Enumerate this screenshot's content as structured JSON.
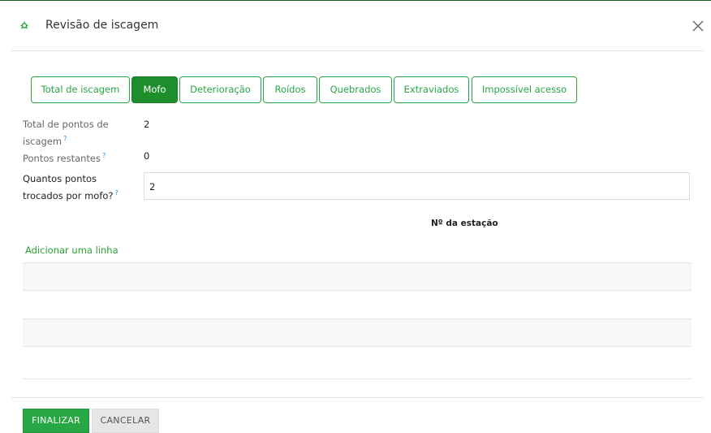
{
  "dialog": {
    "title": "Revisão de iscagem",
    "accent_color": "#28a745",
    "header_icon": "bug-icon",
    "close_icon": "close-icon"
  },
  "tabs": [
    {
      "label": "Total de iscagem",
      "active": false
    },
    {
      "label": "Mofo",
      "active": true
    },
    {
      "label": "Deterioração",
      "active": false
    },
    {
      "label": "Roídos",
      "active": false
    },
    {
      "label": "Quebrados",
      "active": false
    },
    {
      "label": "Extraviados",
      "active": false
    },
    {
      "label": "Impossível acesso",
      "active": false
    }
  ],
  "fields": {
    "total_pontos": {
      "label_line1": "Total de pontos de",
      "label_line2": "iscagem",
      "help": "?",
      "value": "2"
    },
    "pontos_restantes": {
      "label": "Pontos restantes",
      "help": "?",
      "value": "0"
    },
    "quantos_pontos": {
      "label_line1": "Quantos pontos",
      "label_line2": "trocados por mofo?",
      "help": "?",
      "value": "2"
    }
  },
  "table": {
    "column_header": "Nº da estação",
    "add_line_label": "Adicionar uma linha"
  },
  "footer": {
    "finalize_label": "FINALIZAR",
    "cancel_label": "CANCELAR"
  }
}
